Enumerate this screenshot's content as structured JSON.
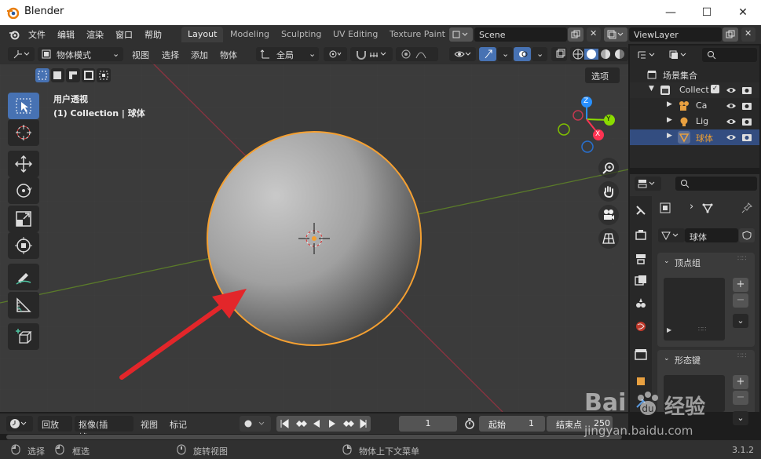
{
  "window": {
    "title": "Blender",
    "minimize": "—",
    "maximize": "☐",
    "close": "✕"
  },
  "menus": [
    "文件",
    "编辑",
    "渲染",
    "窗口",
    "帮助"
  ],
  "workspaces": [
    "Layout",
    "Modeling",
    "Sculpting",
    "UV Editing",
    "Texture Paint"
  ],
  "scene": {
    "value": "Scene"
  },
  "view_layer": {
    "value": "ViewLayer"
  },
  "viewport_header": {
    "mode": "物体模式",
    "menus": [
      "视图",
      "选择",
      "添加",
      "物体"
    ],
    "transform": "全局"
  },
  "options_label": "选项",
  "viewport_overlay": {
    "line1": "用户透视",
    "line2": "(1) Collection | 球体"
  },
  "gizmo": {
    "x": "X",
    "y": "Y",
    "z": "Z"
  },
  "outliner": {
    "root": "场景集合",
    "collection": "Collect",
    "items": [
      {
        "label": "Ca"
      },
      {
        "label": "Lig"
      },
      {
        "label": "球体"
      }
    ]
  },
  "properties": {
    "mesh_name": "球体",
    "panel_vertex_groups": "顶点组",
    "panel_shape_keys": "形态键",
    "plus": "+",
    "minus": "−"
  },
  "timeline": {
    "playback": "回放",
    "keying": "抠像(插帧)",
    "view": "视图",
    "marker": "标记",
    "current_frame": "1",
    "start_label": "起始",
    "start": "1",
    "end_label": "结束点",
    "end": "250"
  },
  "statusbar": {
    "select": "选择",
    "box_select": "框选",
    "rotate_view": "旋转视图",
    "context_menu": "物体上下文菜单",
    "version": "3.1.2"
  },
  "watermark": {
    "brand": "Bai",
    "brand2": "经验",
    "url": "jingyan.baidu.com"
  },
  "colors": {
    "accent": "#4772b3",
    "selection_outline": "#f5a031",
    "arrow": "#e3262a",
    "x_axis": "#ff3352",
    "y_axis": "#8bdc00",
    "z_axis": "#2890ff"
  }
}
